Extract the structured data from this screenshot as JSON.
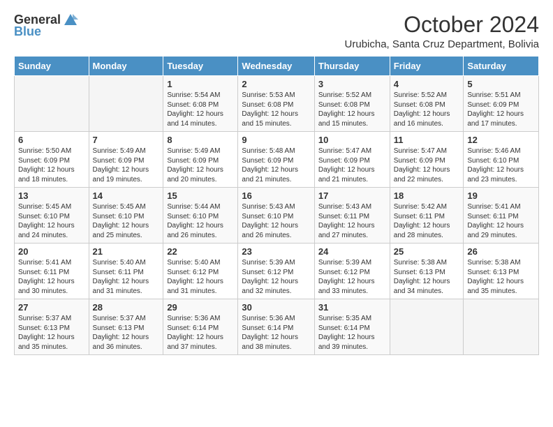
{
  "logo": {
    "general": "General",
    "blue": "Blue"
  },
  "title": "October 2024",
  "subtitle": "Urubicha, Santa Cruz Department, Bolivia",
  "days_header": [
    "Sunday",
    "Monday",
    "Tuesday",
    "Wednesday",
    "Thursday",
    "Friday",
    "Saturday"
  ],
  "weeks": [
    [
      {
        "day": "",
        "info": ""
      },
      {
        "day": "",
        "info": ""
      },
      {
        "day": "1",
        "info": "Sunrise: 5:54 AM\nSunset: 6:08 PM\nDaylight: 12 hours and 14 minutes."
      },
      {
        "day": "2",
        "info": "Sunrise: 5:53 AM\nSunset: 6:08 PM\nDaylight: 12 hours and 15 minutes."
      },
      {
        "day": "3",
        "info": "Sunrise: 5:52 AM\nSunset: 6:08 PM\nDaylight: 12 hours and 15 minutes."
      },
      {
        "day": "4",
        "info": "Sunrise: 5:52 AM\nSunset: 6:08 PM\nDaylight: 12 hours and 16 minutes."
      },
      {
        "day": "5",
        "info": "Sunrise: 5:51 AM\nSunset: 6:09 PM\nDaylight: 12 hours and 17 minutes."
      }
    ],
    [
      {
        "day": "6",
        "info": "Sunrise: 5:50 AM\nSunset: 6:09 PM\nDaylight: 12 hours and 18 minutes."
      },
      {
        "day": "7",
        "info": "Sunrise: 5:49 AM\nSunset: 6:09 PM\nDaylight: 12 hours and 19 minutes."
      },
      {
        "day": "8",
        "info": "Sunrise: 5:49 AM\nSunset: 6:09 PM\nDaylight: 12 hours and 20 minutes."
      },
      {
        "day": "9",
        "info": "Sunrise: 5:48 AM\nSunset: 6:09 PM\nDaylight: 12 hours and 21 minutes."
      },
      {
        "day": "10",
        "info": "Sunrise: 5:47 AM\nSunset: 6:09 PM\nDaylight: 12 hours and 21 minutes."
      },
      {
        "day": "11",
        "info": "Sunrise: 5:47 AM\nSunset: 6:09 PM\nDaylight: 12 hours and 22 minutes."
      },
      {
        "day": "12",
        "info": "Sunrise: 5:46 AM\nSunset: 6:10 PM\nDaylight: 12 hours and 23 minutes."
      }
    ],
    [
      {
        "day": "13",
        "info": "Sunrise: 5:45 AM\nSunset: 6:10 PM\nDaylight: 12 hours and 24 minutes."
      },
      {
        "day": "14",
        "info": "Sunrise: 5:45 AM\nSunset: 6:10 PM\nDaylight: 12 hours and 25 minutes."
      },
      {
        "day": "15",
        "info": "Sunrise: 5:44 AM\nSunset: 6:10 PM\nDaylight: 12 hours and 26 minutes."
      },
      {
        "day": "16",
        "info": "Sunrise: 5:43 AM\nSunset: 6:10 PM\nDaylight: 12 hours and 26 minutes."
      },
      {
        "day": "17",
        "info": "Sunrise: 5:43 AM\nSunset: 6:11 PM\nDaylight: 12 hours and 27 minutes."
      },
      {
        "day": "18",
        "info": "Sunrise: 5:42 AM\nSunset: 6:11 PM\nDaylight: 12 hours and 28 minutes."
      },
      {
        "day": "19",
        "info": "Sunrise: 5:41 AM\nSunset: 6:11 PM\nDaylight: 12 hours and 29 minutes."
      }
    ],
    [
      {
        "day": "20",
        "info": "Sunrise: 5:41 AM\nSunset: 6:11 PM\nDaylight: 12 hours and 30 minutes."
      },
      {
        "day": "21",
        "info": "Sunrise: 5:40 AM\nSunset: 6:11 PM\nDaylight: 12 hours and 31 minutes."
      },
      {
        "day": "22",
        "info": "Sunrise: 5:40 AM\nSunset: 6:12 PM\nDaylight: 12 hours and 31 minutes."
      },
      {
        "day": "23",
        "info": "Sunrise: 5:39 AM\nSunset: 6:12 PM\nDaylight: 12 hours and 32 minutes."
      },
      {
        "day": "24",
        "info": "Sunrise: 5:39 AM\nSunset: 6:12 PM\nDaylight: 12 hours and 33 minutes."
      },
      {
        "day": "25",
        "info": "Sunrise: 5:38 AM\nSunset: 6:13 PM\nDaylight: 12 hours and 34 minutes."
      },
      {
        "day": "26",
        "info": "Sunrise: 5:38 AM\nSunset: 6:13 PM\nDaylight: 12 hours and 35 minutes."
      }
    ],
    [
      {
        "day": "27",
        "info": "Sunrise: 5:37 AM\nSunset: 6:13 PM\nDaylight: 12 hours and 35 minutes."
      },
      {
        "day": "28",
        "info": "Sunrise: 5:37 AM\nSunset: 6:13 PM\nDaylight: 12 hours and 36 minutes."
      },
      {
        "day": "29",
        "info": "Sunrise: 5:36 AM\nSunset: 6:14 PM\nDaylight: 12 hours and 37 minutes."
      },
      {
        "day": "30",
        "info": "Sunrise: 5:36 AM\nSunset: 6:14 PM\nDaylight: 12 hours and 38 minutes."
      },
      {
        "day": "31",
        "info": "Sunrise: 5:35 AM\nSunset: 6:14 PM\nDaylight: 12 hours and 39 minutes."
      },
      {
        "day": "",
        "info": ""
      },
      {
        "day": "",
        "info": ""
      }
    ]
  ]
}
